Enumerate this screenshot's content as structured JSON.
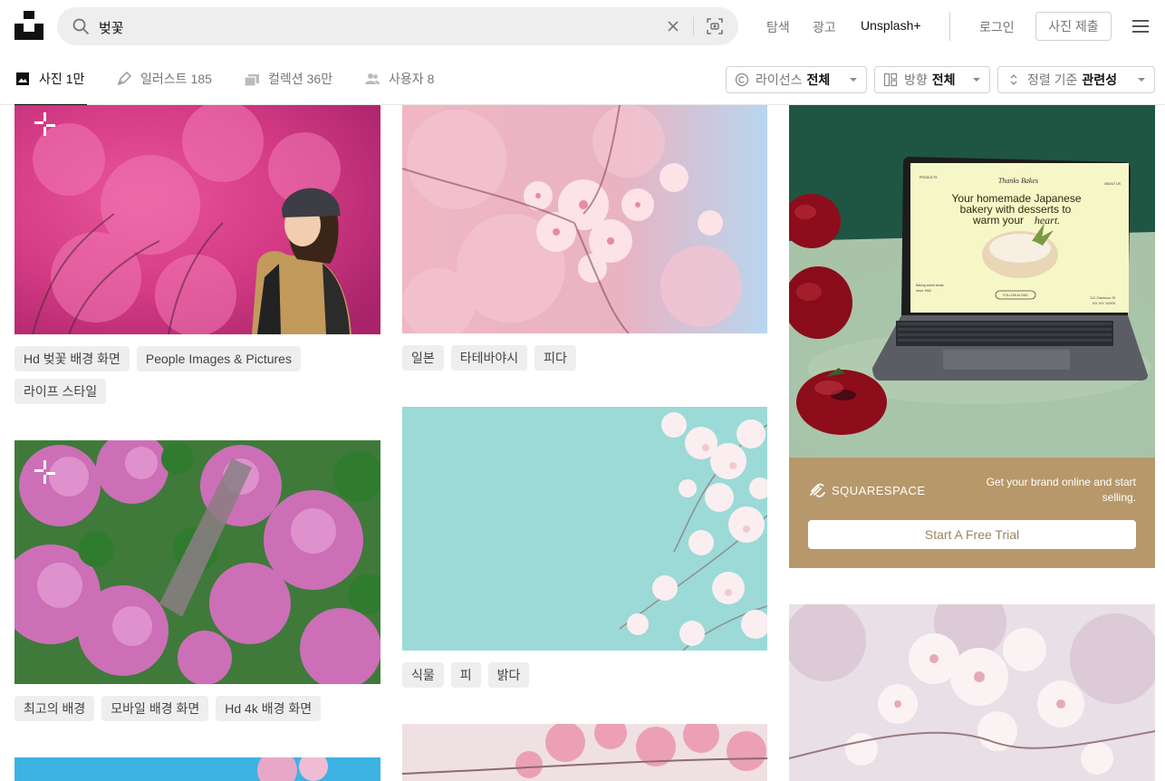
{
  "header": {
    "search_value": "벚꽃",
    "nav": [
      "탐색",
      "광고",
      "Unsplash+"
    ],
    "login": "로그인",
    "submit_photo": "사진 제출"
  },
  "tabs": [
    {
      "label": "사진",
      "count": "1만",
      "icon": "image-icon",
      "active": true
    },
    {
      "label": "일러스트",
      "count": "185",
      "icon": "pen-icon",
      "active": false
    },
    {
      "label": "컬렉션",
      "count": "36만",
      "icon": "collections-icon",
      "active": false
    },
    {
      "label": "사용자",
      "count": "8",
      "icon": "users-icon",
      "active": false
    }
  ],
  "filters": [
    {
      "label": "라이선스",
      "value": "전체",
      "icon": "copyright-icon"
    },
    {
      "label": "방향",
      "value": "전체",
      "icon": "orientation-icon"
    },
    {
      "label": "정렬 기준",
      "value": "관련성",
      "icon": "sort-icon"
    }
  ],
  "photo_tags": {
    "photo1": [
      "Hd 벚꽃 배경 화면",
      "People Images & Pictures",
      "라이프 스타일"
    ],
    "photo2": [
      "일본",
      "타테바야시",
      "피다"
    ],
    "photo3": [
      "최고의 배경",
      "모바일 배경 화면",
      "Hd 4k 배경 화면"
    ],
    "photo4": [
      "식물",
      "피",
      "밝다"
    ]
  },
  "ad": {
    "brand": "SQUARESPACE",
    "copy": "Get your brand online and start selling.",
    "cta": "Start A Free Trial",
    "screen": {
      "left_nav": "PRODUCTS",
      "right_nav": "ABOUT US",
      "logo": "Thanks Bakes",
      "headline_1": "Your homemade Japanese",
      "headline_2": "bakery with desserts to",
      "headline_3": "warm your",
      "headline_em": "heart.",
      "note_1": "Baking sweet treats",
      "note_2": "since 1982",
      "button": "FOLLOW ALONG",
      "address_1": "111 Clarkson St",
      "address_2": "NY, NY 10000"
    }
  },
  "colors": {
    "accent": "#111111",
    "muted": "#767676",
    "chip_bg": "#eeeeee",
    "ad_green": "#1f5543",
    "ad_tan": "#b7986a"
  }
}
